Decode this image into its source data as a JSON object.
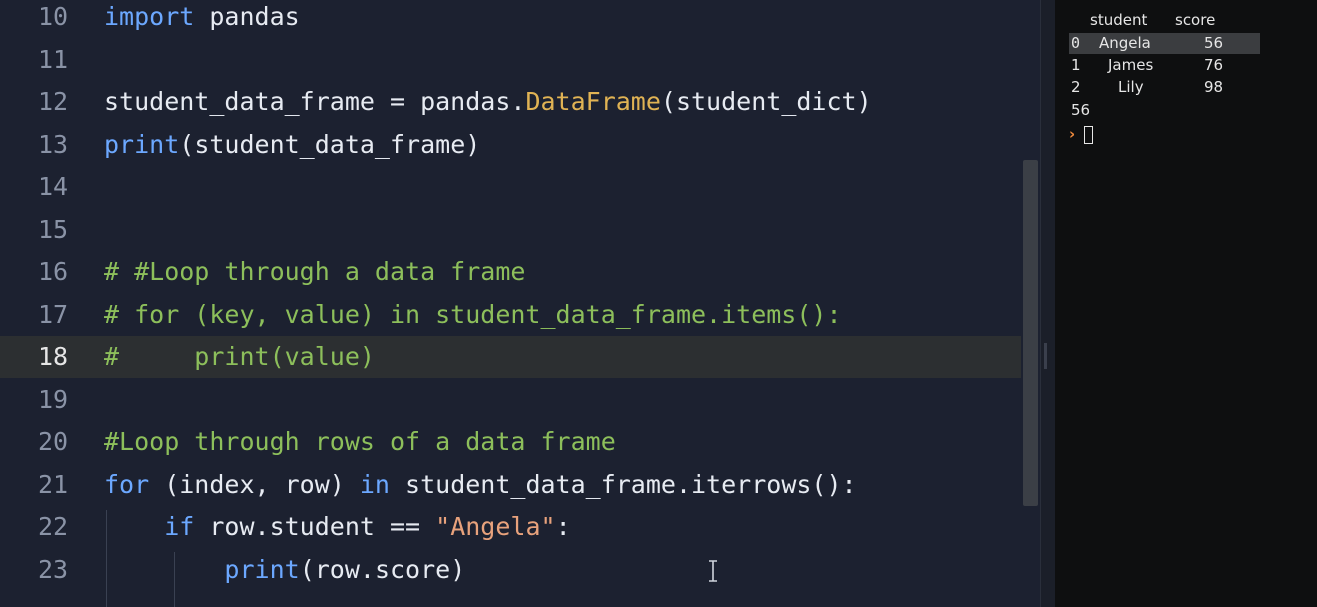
{
  "editor": {
    "active_line": 18,
    "lines": [
      {
        "num": "10",
        "segments": [
          {
            "t": "import",
            "c": "kw"
          },
          {
            "t": " pandas",
            "c": "plain"
          }
        ]
      },
      {
        "num": "11",
        "segments": []
      },
      {
        "num": "12",
        "segments": [
          {
            "t": "student_data_frame = pandas.",
            "c": "plain"
          },
          {
            "t": "DataFrame",
            "c": "cls"
          },
          {
            "t": "(student_dict)",
            "c": "plain"
          }
        ]
      },
      {
        "num": "13",
        "segments": [
          {
            "t": "print",
            "c": "fn"
          },
          {
            "t": "(student_data_frame)",
            "c": "plain"
          }
        ]
      },
      {
        "num": "14",
        "segments": []
      },
      {
        "num": "15",
        "segments": []
      },
      {
        "num": "16",
        "segments": [
          {
            "t": "# #Loop through a data frame",
            "c": "cm"
          }
        ]
      },
      {
        "num": "17",
        "segments": [
          {
            "t": "# for (key, value) in student_data_frame.items():",
            "c": "cm"
          }
        ]
      },
      {
        "num": "18",
        "segments": [
          {
            "t": "#     print(value)",
            "c": "cm"
          }
        ]
      },
      {
        "num": "19",
        "segments": []
      },
      {
        "num": "20",
        "segments": [
          {
            "t": "#Loop through rows of a data frame",
            "c": "cm"
          }
        ]
      },
      {
        "num": "21",
        "segments": [
          {
            "t": "for",
            "c": "kw"
          },
          {
            "t": " (index, row) ",
            "c": "plain"
          },
          {
            "t": "in",
            "c": "kw"
          },
          {
            "t": " student_data_frame.iterrows():",
            "c": "plain"
          }
        ]
      },
      {
        "num": "22",
        "segments": [
          {
            "t": "    ",
            "c": "plain"
          },
          {
            "t": "if",
            "c": "kw"
          },
          {
            "t": " row.student == ",
            "c": "plain"
          },
          {
            "t": "\"Angela\"",
            "c": "str"
          },
          {
            "t": ":",
            "c": "plain"
          }
        ]
      },
      {
        "num": "23",
        "segments": [
          {
            "t": "        ",
            "c": "plain"
          },
          {
            "t": "print",
            "c": "fn"
          },
          {
            "t": "(row.score)",
            "c": "plain"
          }
        ]
      }
    ]
  },
  "console": {
    "header": {
      "student": "student",
      "score": "score"
    },
    "rows": [
      {
        "index": "0",
        "student": "Angela",
        "score": "56"
      },
      {
        "index": "1",
        "student": "James",
        "score": "76"
      },
      {
        "index": "2",
        "student": "Lily",
        "score": "98"
      }
    ],
    "output": "56",
    "prompt": "›"
  },
  "icons": {
    "text_cursor": "i-beam-cursor-icon",
    "prompt": "chevron-right-icon"
  },
  "colors": {
    "keyword": "#6ca8ff",
    "comment": "#8dbf5b",
    "string": "#e8a27c",
    "class": "#e0b354",
    "prompt": "#f08a3c"
  }
}
